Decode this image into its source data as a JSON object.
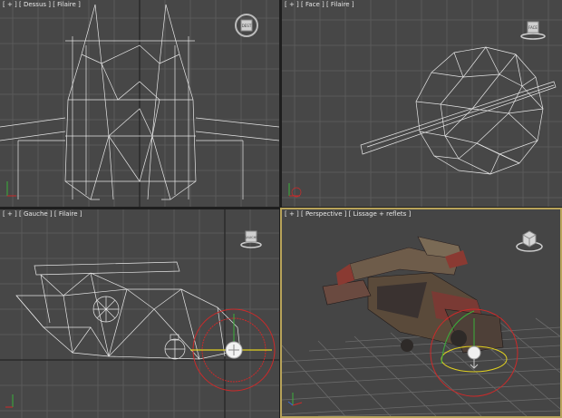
{
  "viewports": {
    "top": {
      "label": "[ + ] [ Dessus ] [ Filaire ]",
      "cube_text": "DEST"
    },
    "front": {
      "label": "[ + ] [ Face ] [ Filaire ]",
      "cube_text": "FACE"
    },
    "left": {
      "label": "[ + ] [ Gauche ] [ Filaire ]",
      "cube_text": "GAUCHE"
    },
    "perspective": {
      "label": "[ + ] [ Perspective ] [ Lissage + reflets ]"
    }
  },
  "colors": {
    "viewport_bg": "#474747",
    "grid_line": "#5a5a5a",
    "grid_axis": "#2a2a2a",
    "wireframe": "#e6e6e6",
    "active_border": "#b8a35a",
    "gizmo_red": "#cc2a2a",
    "gizmo_green": "#3ab03a",
    "gizmo_yellow": "#e0d020"
  }
}
